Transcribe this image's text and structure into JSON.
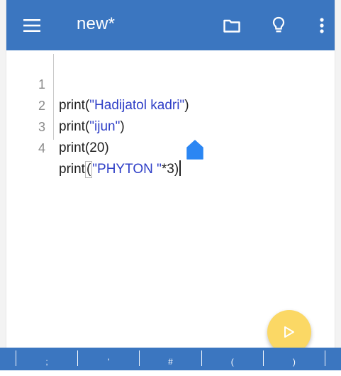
{
  "appbar": {
    "title": "new*",
    "icons": [
      "menu-icon",
      "folder-icon",
      "lightbulb-icon",
      "more-vertical-icon"
    ],
    "color": "#3b76c0"
  },
  "editor": {
    "lines": [
      {
        "number": "1",
        "prefix": "print(",
        "string": "\"Hadijatol kadri\"",
        "suffix": ")"
      },
      {
        "number": "2",
        "prefix": "print(",
        "string": "\"ijun\"",
        "suffix": ")"
      },
      {
        "number": "3",
        "prefix": "print(20)",
        "string": "",
        "suffix": ""
      },
      {
        "number": "4",
        "prefix": "print",
        "bracket": "(",
        "string": "\"PHYTON \"",
        "suffix": "*3)"
      }
    ],
    "string_color": "#2f3fc7"
  },
  "fab": {
    "icon": "play-icon",
    "color": "#fbd865"
  },
  "keybar": {
    "keys": [
      ";",
      "'",
      "#",
      "(",
      ")"
    ]
  }
}
